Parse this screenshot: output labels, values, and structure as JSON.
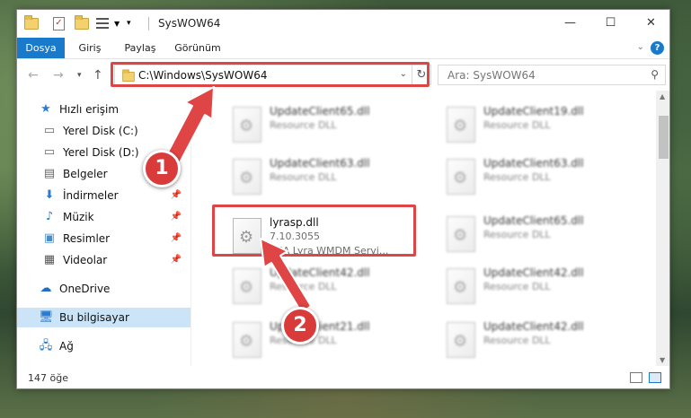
{
  "window": {
    "title": "SysWOW64",
    "controls": {
      "minimize": "—",
      "maximize": "☐",
      "close": "✕"
    }
  },
  "ribbon": {
    "tabs": [
      {
        "label": "Dosya",
        "active": true
      },
      {
        "label": "Giriş"
      },
      {
        "label": "Paylaş"
      },
      {
        "label": "Görünüm"
      }
    ],
    "help": "?"
  },
  "nav": {
    "address": "C:\\Windows\\SysWOW64",
    "search_placeholder": "Ara: SysWOW64"
  },
  "sidebar": {
    "items": [
      {
        "label": "Hızlı erişim",
        "icon": "star-icon"
      },
      {
        "label": "Yerel Disk (C:)",
        "icon": "drive-icon"
      },
      {
        "label": "Yerel Disk (D:)",
        "icon": "drive-icon"
      },
      {
        "label": "Belgeler",
        "icon": "documents-icon"
      },
      {
        "label": "İndirmeler",
        "icon": "download-icon"
      },
      {
        "label": "Müzik",
        "icon": "music-icon"
      },
      {
        "label": "Resimler",
        "icon": "pictures-icon"
      },
      {
        "label": "Videolar",
        "icon": "videos-icon"
      },
      {
        "label": "OneDrive",
        "icon": "cloud-icon"
      },
      {
        "label": "Bu bilgisayar",
        "icon": "computer-icon",
        "selected": true
      },
      {
        "label": "Ağ",
        "icon": "network-icon"
      }
    ]
  },
  "files": [
    {
      "name": "UpdateClient65.dll",
      "type": "Resource DLL",
      "blurred": true
    },
    {
      "name": "UpdateClient19.dll",
      "type": "Resource DLL",
      "blurred": true
    },
    {
      "name": "UpdateClient63.dll",
      "type": "Resource DLL",
      "blurred": true
    },
    {
      "name": "UpdateClient63.dll",
      "type": "Resource DLL",
      "blurred": true
    },
    {
      "name": "lyrasp.dll",
      "version": "7.10.3055",
      "type": "RCA Lyra WMDM Servi...",
      "blurred": false
    },
    {
      "name": "UpdateClient65.dll",
      "type": "Resource DLL",
      "blurred": true
    },
    {
      "name": "UpdateClient42.dll",
      "type": "Resource DLL",
      "blurred": true
    },
    {
      "name": "UpdateClient42.dll",
      "type": "Resource DLL",
      "blurred": true
    },
    {
      "name": "UpdateClient21.dll",
      "type": "Resource DLL",
      "blurred": true
    },
    {
      "name": "UpdateClient42.dll",
      "type": "Resource DLL",
      "blurred": true
    }
  ],
  "status": {
    "count": "147 öğe"
  },
  "annotations": {
    "step1": "1",
    "step2": "2",
    "color": "#e04545"
  }
}
